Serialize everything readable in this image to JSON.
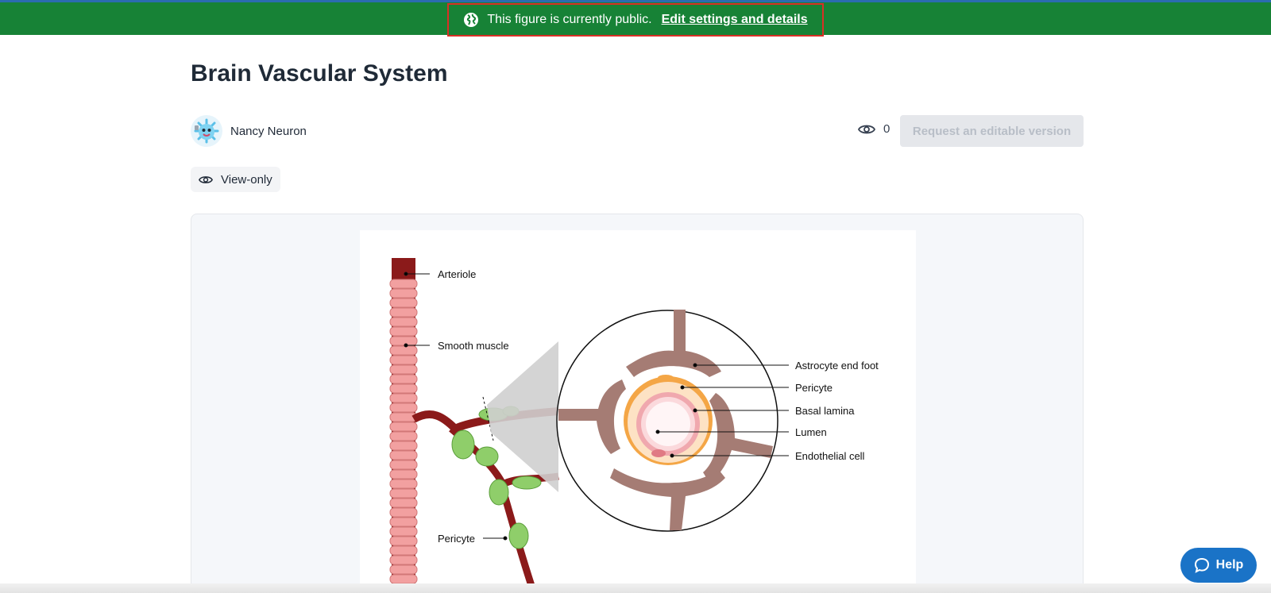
{
  "banner": {
    "message": "This figure is currently public.",
    "link": "Edit settings and details",
    "icon": "globe-icon"
  },
  "figure": {
    "title": "Brain Vascular System",
    "author": "Nancy Neuron",
    "views": "0",
    "request_button": "Request an editable version",
    "access_badge": "View-only",
    "labels": {
      "arteriole": "Arteriole",
      "smooth_muscle": "Smooth muscle",
      "pericyte_left": "Pericyte",
      "astrocyte": "Astrocyte end foot",
      "pericyte": "Pericyte",
      "basal_lamina": "Basal lamina",
      "lumen": "Lumen",
      "endothelial": "Endothelial cell"
    }
  },
  "help": {
    "label": "Help"
  },
  "colors": {
    "banner": "#178236",
    "help": "#1a73c7",
    "vessel": "#8b1a1a",
    "smooth_muscle": "#f2a0a0",
    "pericyte": "#8fce6a",
    "astrocyte": "#a57c74"
  }
}
